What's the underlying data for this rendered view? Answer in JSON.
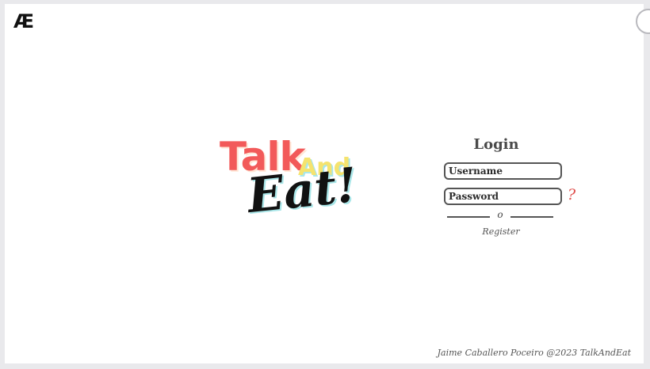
{
  "brand": {
    "mark": "Æ"
  },
  "logo": {
    "talk": "Talk",
    "and": "And",
    "eat": "Eat!"
  },
  "login": {
    "title": "Login",
    "username_placeholder": "Username",
    "password_placeholder": "Password",
    "help_symbol": "?",
    "divider_text": "o",
    "register_label": "Register"
  },
  "footer": {
    "text": "Jaime Caballero Poceiro @2023 TalkAndEat"
  },
  "colors": {
    "accent_red": "#f25a5a",
    "accent_yellow": "#f5e36e",
    "accent_cyan": "#a9e6e8",
    "help_red": "#e0524f"
  },
  "icons": {
    "help": "question-mark-icon"
  }
}
